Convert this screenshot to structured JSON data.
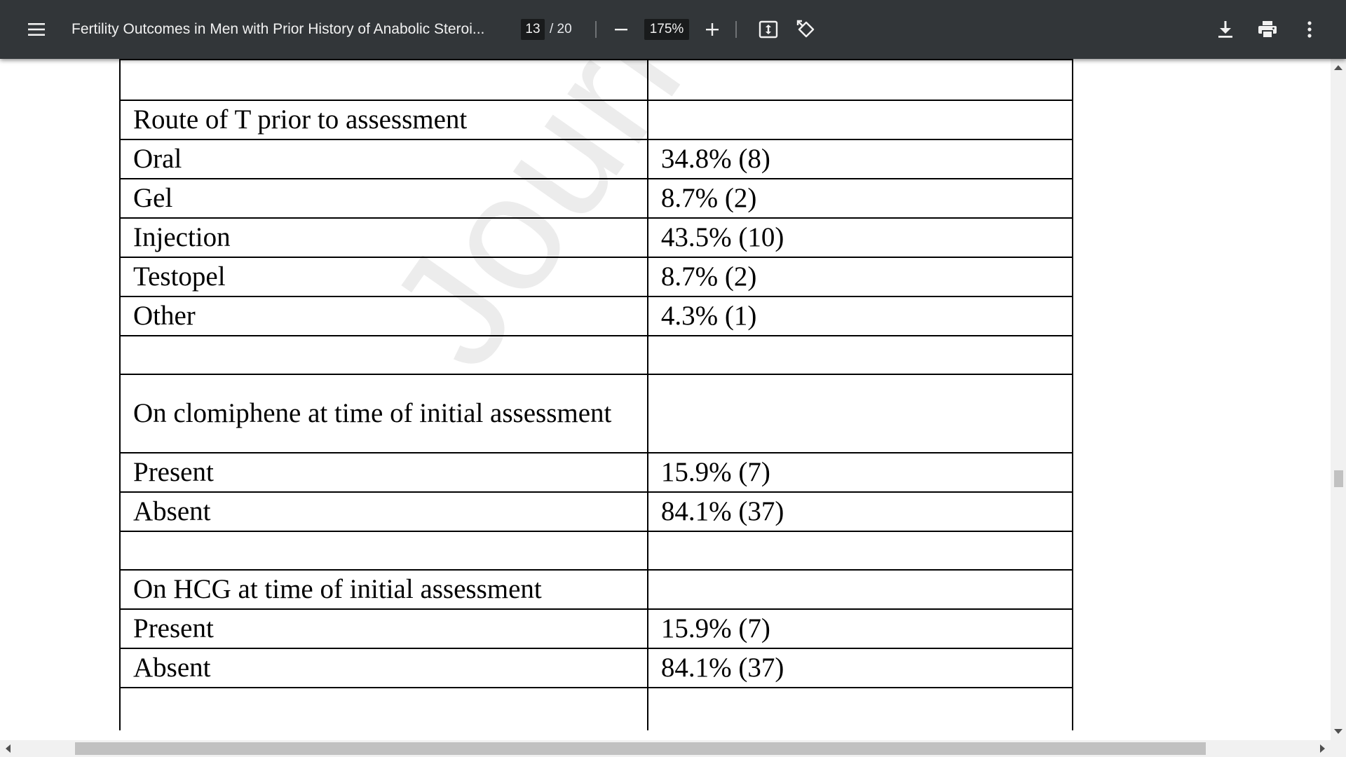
{
  "toolbar": {
    "title": "Fertility Outcomes in Men with Prior History of Anabolic Steroi...",
    "page_current": "13",
    "page_total": "/ 20",
    "zoom": "175%",
    "icons": {
      "menu": "hamburger-menu-icon",
      "zoom_out": "minus-icon",
      "zoom_in": "plus-icon",
      "fit": "fit-to-page-icon",
      "rotate": "rotate-icon",
      "download": "download-icon",
      "print": "print-icon",
      "more": "more-vertical-icon"
    }
  },
  "document": {
    "watermark": "Journal Pre-pr",
    "rows": [
      {
        "label": "",
        "value": ""
      },
      {
        "label": "Route of T prior to assessment",
        "value": ""
      },
      {
        "label": "Oral",
        "value": "34.8% (8)"
      },
      {
        "label": "Gel",
        "value": "8.7% (2)"
      },
      {
        "label": "Injection",
        "value": "43.5% (10)"
      },
      {
        "label": "Testopel",
        "value": "8.7% (2)"
      },
      {
        "label": "Other",
        "value": "4.3% (1)"
      },
      {
        "label": "",
        "value": ""
      },
      {
        "label": "On clomiphene at time of initial assessment",
        "value": ""
      },
      {
        "label": "Present",
        "value": "15.9% (7)"
      },
      {
        "label": "Absent",
        "value": "84.1% (37)"
      },
      {
        "label": "",
        "value": ""
      },
      {
        "label": "On HCG at time of initial assessment",
        "value": ""
      },
      {
        "label": "Present",
        "value": "15.9% (7)"
      },
      {
        "label": "Absent",
        "value": "84.1% (37)"
      },
      {
        "label": "",
        "value": ""
      }
    ]
  },
  "colors": {
    "toolbar_bg": "#323639",
    "toolbar_text": "#f1f1f1",
    "input_bg": "#191b1c",
    "page_bg": "#ffffff",
    "watermark": "#ececec",
    "scrollbar_track": "#f1f1f1",
    "scrollbar_thumb": "#c1c1c1"
  }
}
